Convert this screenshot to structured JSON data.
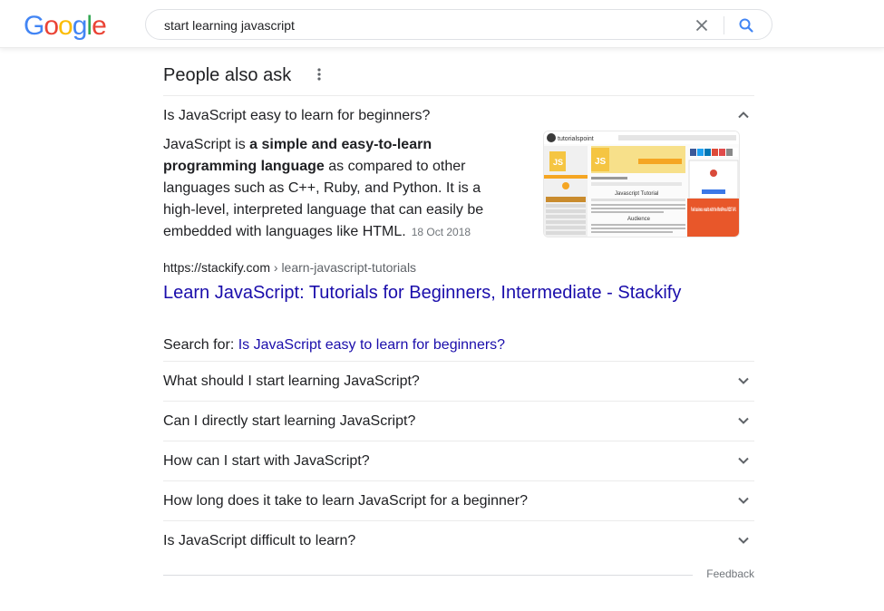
{
  "header": {
    "logo_letters": [
      {
        "ch": "G",
        "color": "#4285F4"
      },
      {
        "ch": "o",
        "color": "#EA4335"
      },
      {
        "ch": "o",
        "color": "#FBBC05"
      },
      {
        "ch": "g",
        "color": "#4285F4"
      },
      {
        "ch": "l",
        "color": "#34A853"
      },
      {
        "ch": "e",
        "color": "#EA4335"
      }
    ],
    "search_query": "start learning javascript",
    "clear_icon": "close-icon",
    "search_icon": "search-icon"
  },
  "paa": {
    "title": "People also ask",
    "expanded_question": "Is JavaScript easy to learn for beginners?",
    "answer": {
      "part1": "JavaScript is ",
      "bold": "a simple and easy-to-learn programming language",
      "part2": " as compared to other languages such as C++, Ruby, and Python. It is a high-level, interpreted language that can easily be embedded with languages like HTML.",
      "date": "18 Oct 2018"
    },
    "source": {
      "domain": "https://stackify.com",
      "breadcrumb": " › learn-javascript-tutorials",
      "title": "Learn JavaScript: Tutorials for Beginners, Intermediate - Stackify"
    },
    "search_for": {
      "label": "Search for: ",
      "query": "Is JavaScript easy to learn for beginners?"
    },
    "questions": [
      "What should I start learning JavaScript?",
      "Can I directly start learning JavaScript?",
      "How can I start with JavaScript?",
      "How long does it take to learn JavaScript for a beginner?",
      "Is JavaScript difficult to learn?"
    ],
    "feedback": "Feedback"
  },
  "thumbnail": {
    "site_name": "tutorialspoint",
    "page_heading": "Javascript Tutorial",
    "subheading": "Audience",
    "ad_text": "Fuel business results with the WordPress REST API.",
    "accent": "#f5a623",
    "js_badge": "JS"
  },
  "colors": {
    "link": "#1a0dab",
    "text": "#202124",
    "muted": "#70757a"
  }
}
